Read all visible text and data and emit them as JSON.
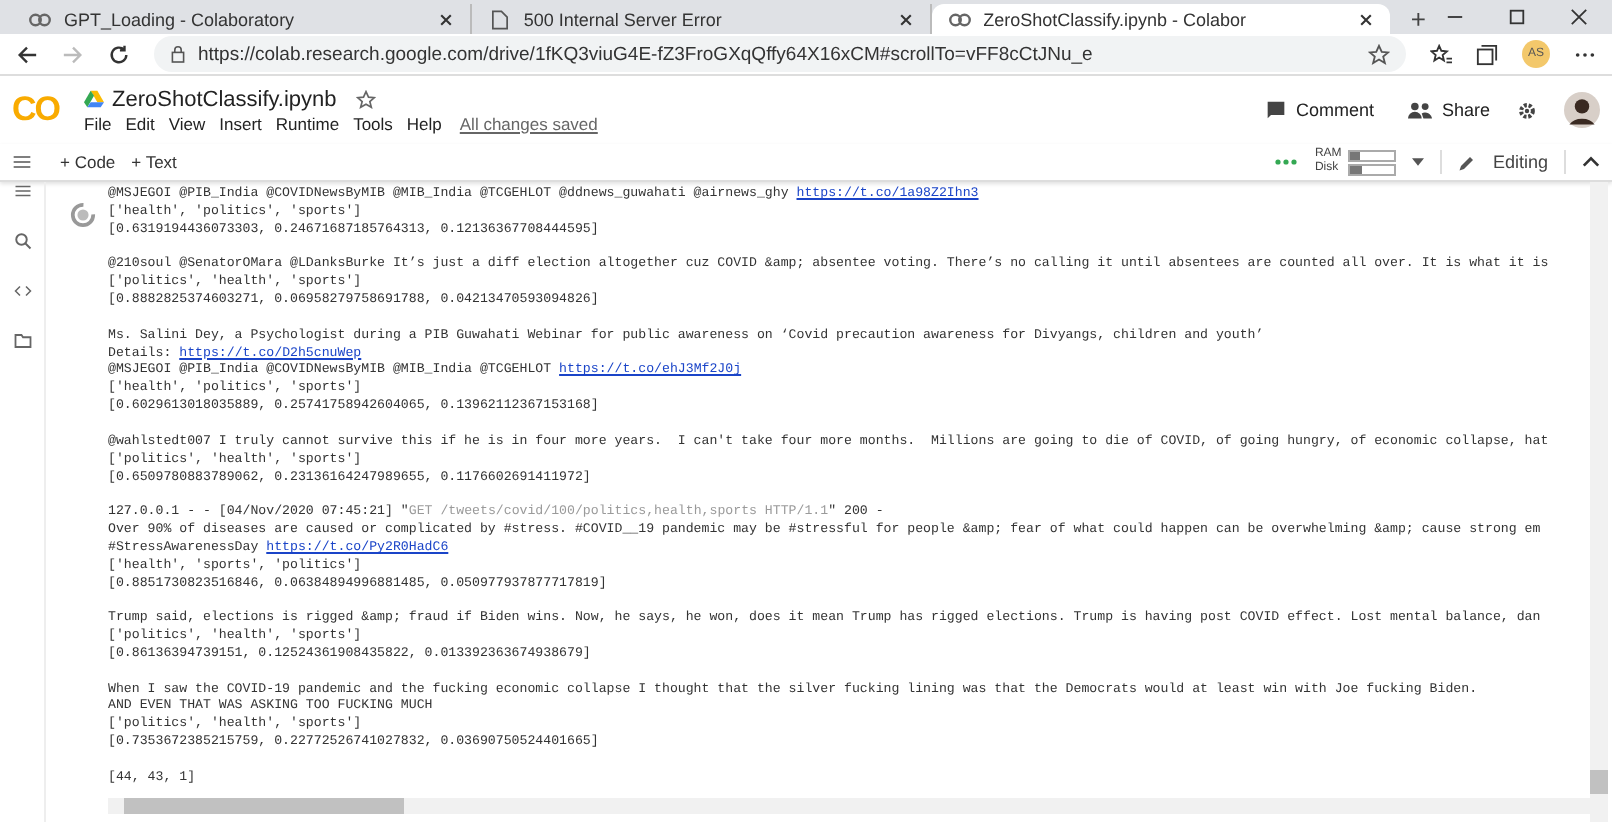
{
  "browser": {
    "tabs": [
      {
        "title": "GPT_Loading - Colaboratory",
        "kind": "notebook",
        "selected": false
      },
      {
        "title": "500 Internal Server Error",
        "kind": "page",
        "selected": false
      },
      {
        "title": "ZeroShotClassify.ipynb - Colabor",
        "kind": "notebook",
        "selected": true
      }
    ],
    "new_tab": "+",
    "url": "https://colab.research.google.com/drive/1fKQ3viuG4E-fZ3FroGXqQffy64X16xCM#scrollTo=vFF8cCtJNu_e",
    "profile": "AS"
  },
  "notebook": {
    "logo": "CO",
    "name": "ZeroShotClassify.ipynb",
    "menu": [
      "File",
      "Edit",
      "View",
      "Insert",
      "Runtime",
      "Tools",
      "Help"
    ],
    "save_status": "All changes saved",
    "comment": "Comment",
    "share": "Share"
  },
  "toolbar": {
    "add_code": "+ Code",
    "add_text": "+ Text",
    "ram": {
      "label": "RAM",
      "level": 0.2
    },
    "disk": {
      "label": "Disk",
      "level": 0.25
    },
    "editing": "Editing"
  },
  "output": [
    {
      "lines": [
        [
          {
            "t": "@MSJEGOI @PIB_India @COVIDNewsByMIB @MIB_India @TCGEHLOT @ddnews_guwahati @airnews_ghy "
          },
          {
            "t": "https://t.co/1a98Z2Ihn3",
            "kind": "link"
          }
        ],
        [
          {
            "t": "['health', 'politics', 'sports']"
          }
        ],
        [
          {
            "t": "[0.6319194436073303, 0.24671687185764313, 0.12136367708444595]"
          }
        ]
      ]
    },
    {
      "lines": [
        [
          {
            "t": "@210soul @SenatorOMara @LDanksBurke It’s just a diff election altogether cuz COVID &amp; absentee voting. There’s no calling it until absentees are counted all over. It is what it is"
          }
        ],
        [
          {
            "t": "['politics', 'health', 'sports']"
          }
        ],
        [
          {
            "t": "[0.8882825374603271, 0.06958279758691788, 0.04213470593094826]"
          }
        ]
      ]
    },
    {
      "lines": [
        [
          {
            "t": "Ms. Salini Dey, a Psychologist during a PIB Guwahati Webinar for public awareness on ‘Covid precaution awareness for Divyangs, children and youth’"
          }
        ],
        [
          {
            "t": "Details: "
          },
          {
            "t": "https://t.co/D2h5cnuWep",
            "kind": "link"
          }
        ],
        [
          {
            "t": "@MSJEGOI @PIB_India @COVIDNewsByMIB @MIB_India @TCGEHLOT "
          },
          {
            "t": "https://t.co/ehJ3Mf2J0j",
            "kind": "link"
          }
        ],
        [
          {
            "t": "['health', 'politics', 'sports']"
          }
        ],
        [
          {
            "t": "[0.6029613018035889, 0.25741758942604065, 0.13962112367153168]"
          }
        ]
      ]
    },
    {
      "lines": [
        [
          {
            "t": "@wahlstedt007 I truly cannot survive this if he is in four more years.  I can't take four more months.  Millions are going to die of COVID, of going hungry, of economic collapse, hat"
          }
        ],
        [
          {
            "t": "['politics', 'health', 'sports']"
          }
        ],
        [
          {
            "t": "[0.6509780883789062, 0.23136164247989655, 0.1176602691411972]"
          }
        ]
      ]
    },
    {
      "lines": [
        [
          {
            "t": "127.0.0.1 - - [04/Nov/2020 07:45:21] \""
          },
          {
            "t": "GET /tweets/covid/100/politics,health,sports HTTP/1.1",
            "kind": "faded"
          },
          {
            "t": "\" 200 -"
          }
        ],
        [
          {
            "t": "Over 90% of diseases are caused or complicated by #stress. #COVID__19 pandemic may be #stressful for people &amp; fear of what could happen can be overwhelming &amp; cause strong em"
          }
        ],
        [
          {
            "t": "#StressAwarenessDay "
          },
          {
            "t": "https://t.co/Py2R0HadC6",
            "kind": "link"
          }
        ],
        [
          {
            "t": "['health', 'sports', 'politics']"
          }
        ],
        [
          {
            "t": "[0.8851730823516846, 0.06384894996881485, 0.050977937877717819]"
          }
        ]
      ]
    },
    {
      "lines": [
        [
          {
            "t": "Trump said, elections is rigged &amp; fraud if Biden wins. Now, he says, he won, does it mean Trump has rigged elections. Trump is having post COVID effect. Lost mental balance, dan"
          }
        ],
        [
          {
            "t": "['politics', 'health', 'sports']"
          }
        ],
        [
          {
            "t": "[0.86136394739151, 0.12524361908435822, 0.013392363674938679]"
          }
        ]
      ]
    },
    {
      "lines": [
        [
          {
            "t": "When I saw the COVID-19 pandemic and the fucking economic collapse I thought that the silver fucking lining was that the Democrats would at least win with Joe fucking Biden."
          }
        ],
        [
          {
            "t": "AND EVEN THAT WAS ASKING TOO FUCKING MUCH"
          }
        ],
        [
          {
            "t": "['politics', 'health', 'sports']"
          }
        ],
        [
          {
            "t": "[0.7353672385215759, 0.22772526741027832, 0.03690750524401665]"
          }
        ]
      ]
    },
    {
      "lines": [
        [
          {
            "t": "[44, 43, 1]"
          }
        ]
      ]
    }
  ]
}
